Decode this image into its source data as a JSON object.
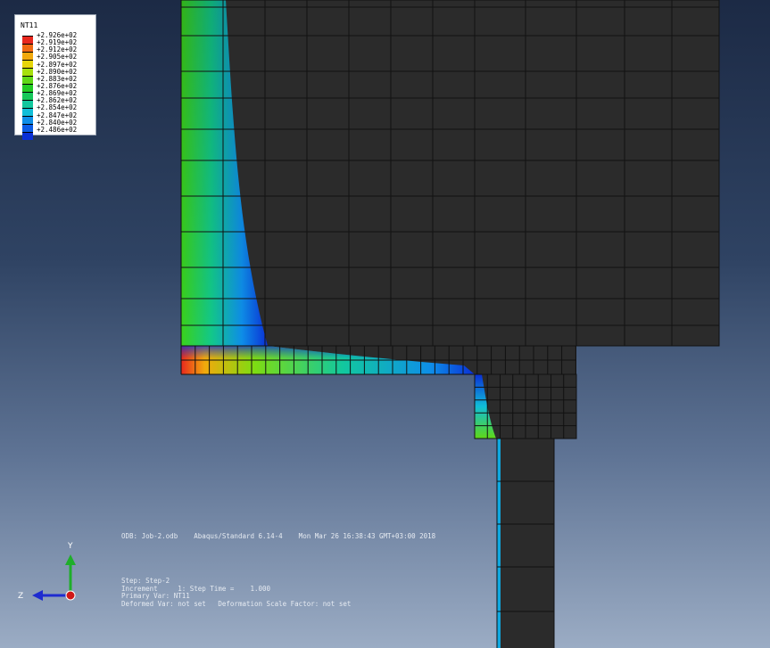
{
  "legend": {
    "title": "NT11",
    "labels": [
      "+2.926e+02",
      "+2.919e+02",
      "+2.912e+02",
      "+2.905e+02",
      "+2.897e+02",
      "+2.890e+02",
      "+2.883e+02",
      "+2.876e+02",
      "+2.869e+02",
      "+2.862e+02",
      "+2.854e+02",
      "+2.847e+02",
      "+2.840e+02",
      "+2.486e+02"
    ],
    "colors": [
      "#e8281e",
      "#f06a12",
      "#f2a90c",
      "#e6d60a",
      "#a6e00c",
      "#5fd816",
      "#22cc24",
      "#16c85a",
      "#12c89e",
      "#10bed8",
      "#0e8ee8",
      "#0c5ce6",
      "#0a2fd6"
    ]
  },
  "info": {
    "odb_line": "ODB: Job-2.odb    Abaqus/Standard 6.14-4    Mon Mar 26 16:38:43 GMT+03:00 2018",
    "step": "Step: Step-2",
    "increment": "Increment     1: Step Time =    1.000",
    "primary_var": "Primary Var: NT11",
    "deformed_var": "Deformed Var: not set   Deformation Scale Factor: not set"
  },
  "triad": {
    "y_label": "Y",
    "z_label": "Z"
  },
  "colors": {
    "mesh_fill": "#2b2b2b",
    "mesh_line": "#111111",
    "axis_y": "#1fae2a",
    "axis_z": "#1e2bd0",
    "axis_x": "#d01818"
  }
}
